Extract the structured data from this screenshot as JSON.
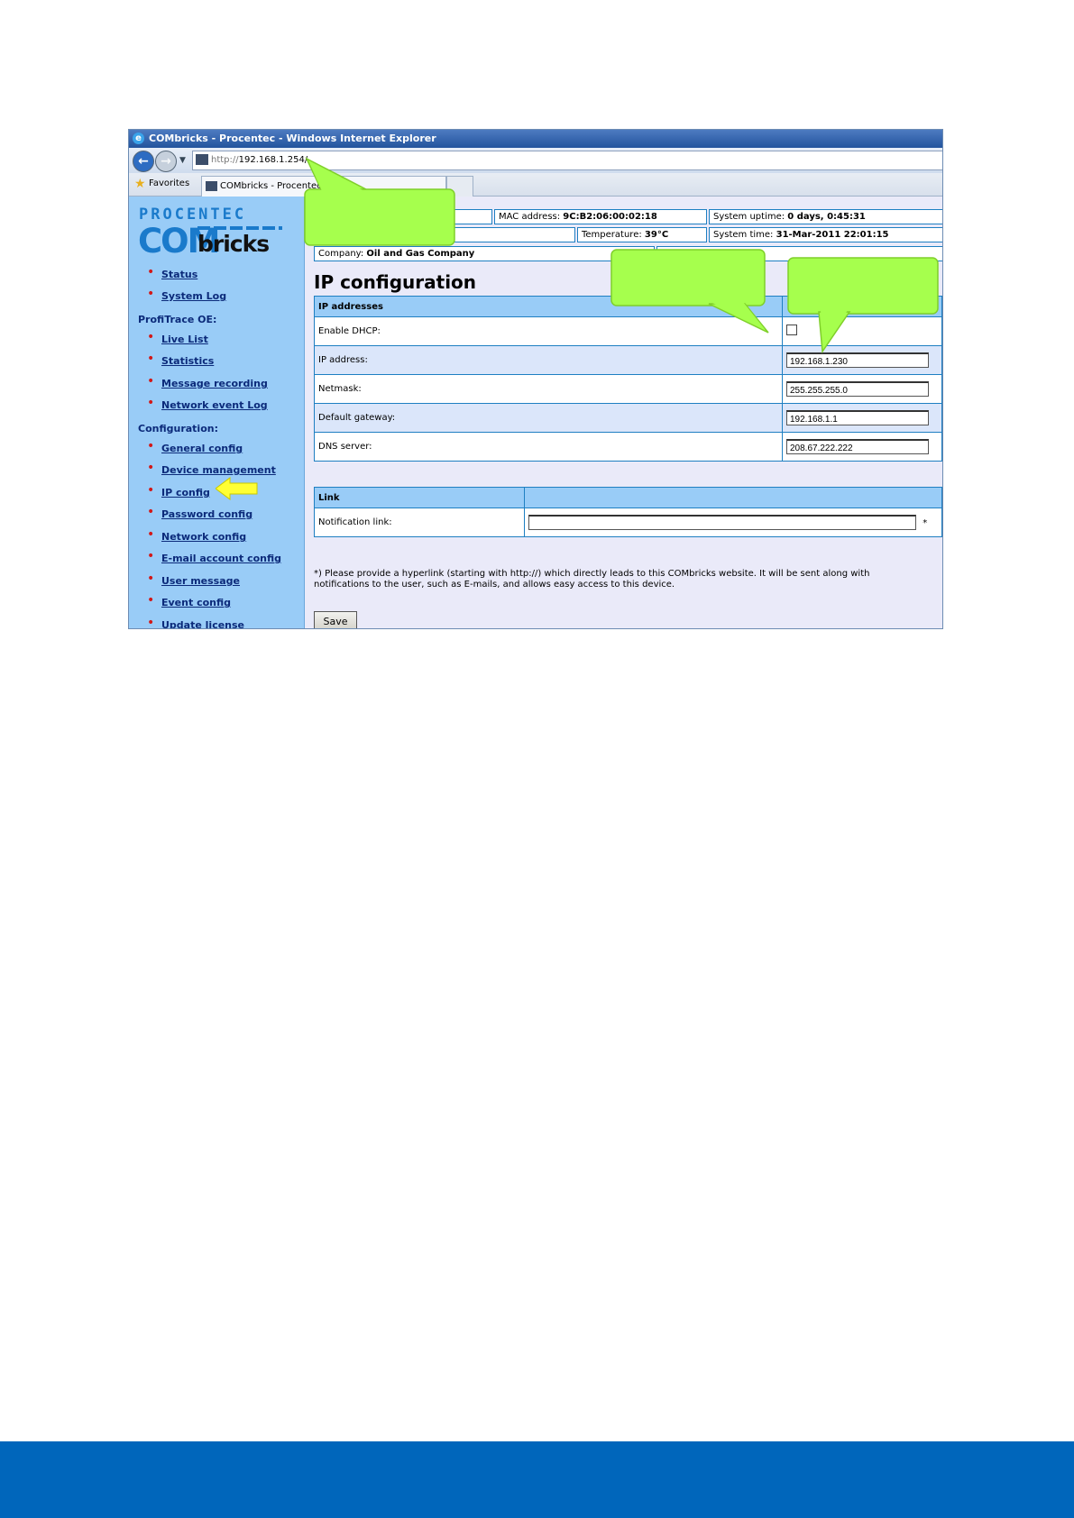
{
  "browser": {
    "title": "COMbricks - Procentec - Windows Internet Explorer",
    "url_protocol": "http://",
    "url_host": "192.168.1.254/",
    "favorites_label": "Favorites",
    "tab_label": "COMbricks - Procentec"
  },
  "logo": {
    "line1": "PROCENTEC",
    "line2a": "COM",
    "line2b": "bricks"
  },
  "sidebar": {
    "items_top": [
      "Status",
      "System Log"
    ],
    "heading_profitrace": "ProfiTrace OE:",
    "items_profitrace": [
      "Live List",
      "Statistics",
      "Message recording",
      "Network event Log"
    ],
    "heading_config": "Configuration:",
    "items_config": [
      "General config",
      "Device management",
      "IP config",
      "Password config",
      "Network config",
      "E-mail account config",
      "User message",
      "Event config",
      "Update license"
    ]
  },
  "status": {
    "mac_label": "MAC address: ",
    "mac_value": "9C:B2:06:00:02:18",
    "uptime_label": "System uptime: ",
    "uptime_value": "0 days, 0:45:31",
    "temp_label": "Temperature: ",
    "temp_value": "39°C",
    "time_label": "System time: ",
    "time_value": "31-Mar-2011 22:01:15",
    "company_label": "Company: ",
    "company_value": "Oil and Gas Company"
  },
  "page": {
    "title": "IP configuration",
    "ip_section_header": "IP addresses",
    "rows": {
      "dhcp_label": "Enable DHCP:",
      "ip_label": "IP address:",
      "ip_value": "192.168.1.230",
      "netmask_label": "Netmask:",
      "netmask_value": "255.255.255.0",
      "gateway_label": "Default gateway:",
      "gateway_value": "192.168.1.1",
      "dns_label": "DNS server:",
      "dns_value": "208.67.222.222"
    },
    "dhcp_checked": false,
    "link_section_header": "Link",
    "notification_label": "Notification link:",
    "notification_value": "",
    "asterisk": "*",
    "note": "*) Please provide a hyperlink (starting with http://) which directly leads to this COMbricks website. It will be sent along with notifications to the user, such as E-mails, and allows easy access to this device.",
    "save_label": "Save"
  },
  "colors": {
    "callout_green": "#a6ff4d",
    "footer_blue": "#0066bb",
    "sidebar_blue": "#99ccf7",
    "arrow_yellow": "#ffff33"
  }
}
